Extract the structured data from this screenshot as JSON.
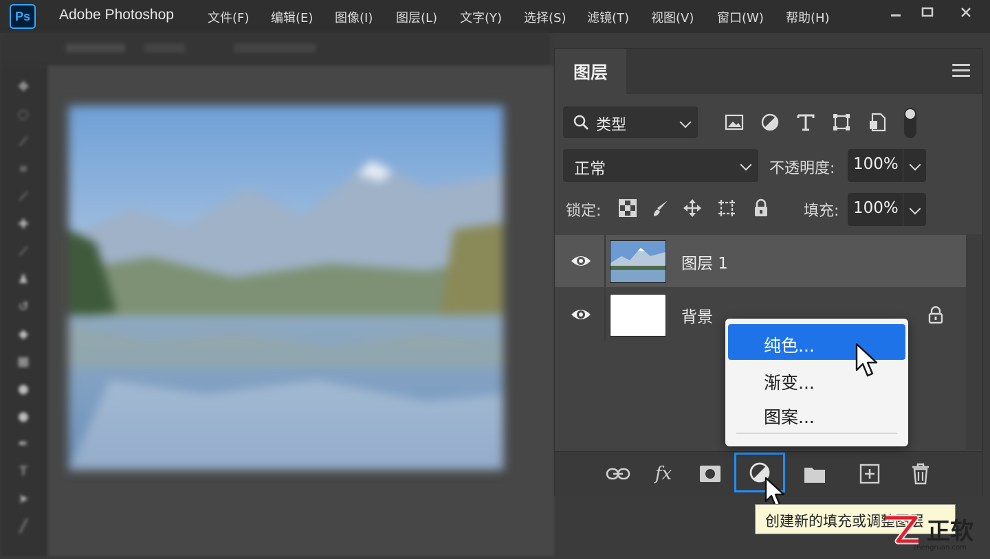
{
  "app": {
    "logo_text": "Ps",
    "title": "Adobe Photoshop"
  },
  "menu": [
    {
      "label": "文件(F)"
    },
    {
      "label": "编辑(E)"
    },
    {
      "label": "图像(I)"
    },
    {
      "label": "图层(L)"
    },
    {
      "label": "文字(Y)"
    },
    {
      "label": "选择(S)"
    },
    {
      "label": "滤镜(T)"
    },
    {
      "label": "视图(V)"
    },
    {
      "label": "窗口(W)"
    },
    {
      "label": "帮助(H)"
    }
  ],
  "window_controls": [
    "minimize-icon",
    "restore-icon",
    "close-icon"
  ],
  "layers_panel": {
    "tab_title": "图层",
    "filter": {
      "label": "类型",
      "icons": [
        "image-filter-icon",
        "adjustment-filter-icon",
        "type-filter-icon",
        "shape-filter-icon",
        "smart-object-filter-icon"
      ]
    },
    "blend_mode": "正常",
    "opacity_label": "不透明度:",
    "opacity_value": "100%",
    "lock_label": "锁定:",
    "lock_icons": [
      "lock-transparent-pixels-icon",
      "lock-image-pixels-icon",
      "lock-position-icon",
      "lock-artboard-icon",
      "lock-all-icon"
    ],
    "fill_label": "填充:",
    "fill_value": "100%",
    "layers": [
      {
        "name": "图层 1",
        "selected": true,
        "thumb": "landscape"
      },
      {
        "name": "背景",
        "selected": false,
        "thumb": "white",
        "locked": true
      }
    ],
    "footer_icons": [
      "link-layers-icon",
      "fx-icon",
      "add-mask-icon",
      "adjustment-layer-icon",
      "new-group-icon",
      "new-layer-icon",
      "delete-layer-icon"
    ]
  },
  "fill_menu": {
    "items": [
      "纯色...",
      "渐变...",
      "图案..."
    ],
    "highlighted_index": 0
  },
  "tooltip": "创建新的填充或调整图层",
  "watermark": {
    "text": "正软",
    "url_text": "zhengruan.com"
  },
  "colors": {
    "accent_blue": "#1f73e8",
    "ps_blue": "#31a8ff",
    "tooltip_bg": "#fbf8d6"
  }
}
